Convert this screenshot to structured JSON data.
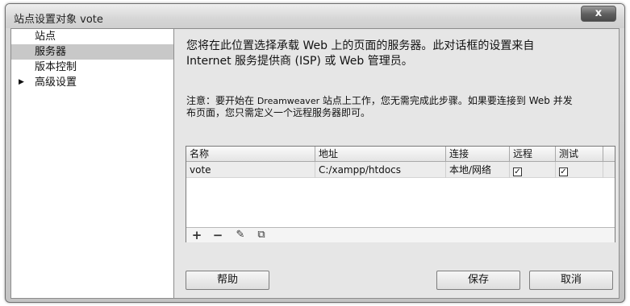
{
  "window": {
    "title": "站点设置对象 vote",
    "close_label": "x"
  },
  "sidebar": {
    "items": [
      {
        "label": "站点"
      },
      {
        "label": "服务器"
      },
      {
        "label": "版本控制"
      },
      {
        "label": "高级设置",
        "arrow": "▶"
      }
    ],
    "selected": "服务器"
  },
  "main": {
    "intro_line1": "您将在此位置选择承载 Web 上的页面的服务器。此对话框的设置来自",
    "intro_line2": "Internet 服务提供商 (ISP) 或 Web 管理员。",
    "note_part1": "注意：要开始在 ",
    "note_brand": "Dreamweaver",
    "note_part2": " 站点上工作，您无需完成此步骤。如果要连接到 Web 并发",
    "note_line2": "布页面，您只需定义一个远程服务器即可。"
  },
  "table": {
    "headers": {
      "name": "名称",
      "address": "地址",
      "connection": "连接",
      "remote": "远程",
      "test": "测试"
    },
    "rows": [
      {
        "name": "vote",
        "address": "C:/xampp/htdocs",
        "connection": "本地/网络",
        "remote": "✓",
        "test": "✓"
      }
    ]
  },
  "toolbar": {
    "add": "+",
    "remove": "−",
    "edit": "✎",
    "duplicate": "⧉"
  },
  "buttons": {
    "help": "帮助",
    "save": "保存",
    "cancel": "取消"
  }
}
